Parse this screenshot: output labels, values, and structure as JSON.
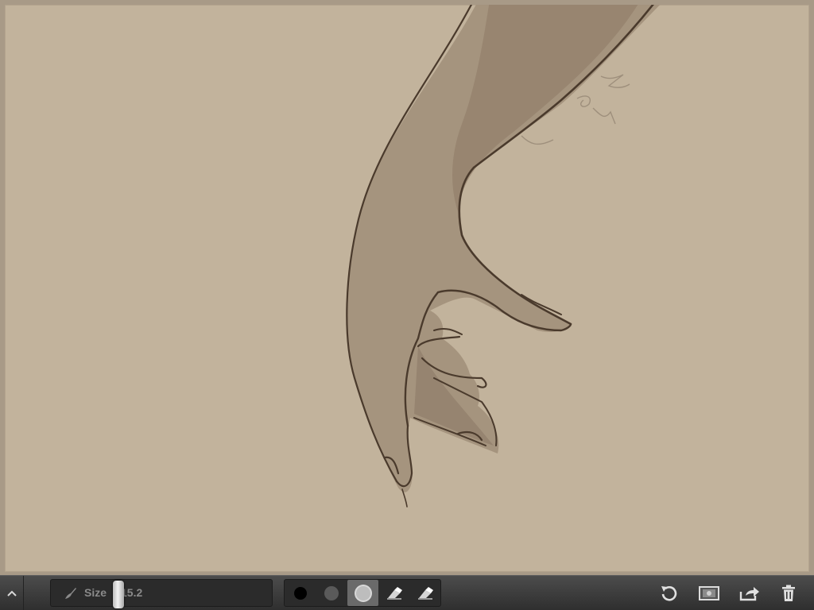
{
  "canvas": {
    "artwork": "hand-sketch"
  },
  "toolbar": {
    "toggle_icon": "chevron-up-icon",
    "size_label": "Size",
    "size_value": "15.2",
    "brushes": [
      {
        "name": "brush-black",
        "color": "#000000"
      },
      {
        "name": "brush-gray",
        "color": "#5a5a5a"
      },
      {
        "name": "brush-light",
        "color": "#bdbdbd",
        "selected": true
      },
      {
        "name": "eraser-1",
        "icon": "eraser-icon"
      },
      {
        "name": "eraser-2",
        "icon": "eraser-icon"
      }
    ],
    "actions": [
      {
        "name": "undo-button",
        "icon": "undo-icon"
      },
      {
        "name": "layers-button",
        "icon": "layers-icon"
      },
      {
        "name": "share-button",
        "icon": "share-icon"
      },
      {
        "name": "trash-button",
        "icon": "trash-icon"
      }
    ]
  },
  "colors": {
    "paper": "#c2b39c",
    "ink": "#4a3a2c",
    "shade": "#a2907b",
    "toolbar": "#3a3a3a"
  }
}
